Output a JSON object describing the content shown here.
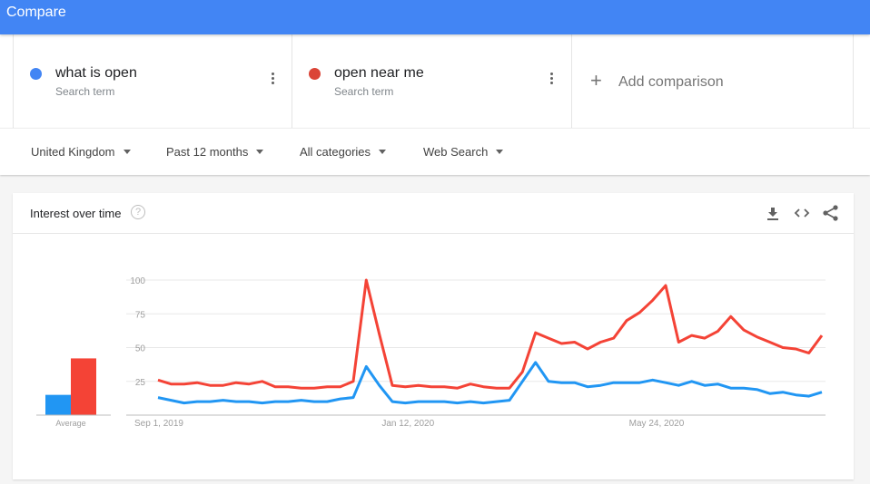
{
  "header": {
    "title": "Compare"
  },
  "terms": [
    {
      "name": "what is open",
      "subtitle": "Search term",
      "color": "#4285f4"
    },
    {
      "name": "open near me",
      "subtitle": "Search term",
      "color": "#db4437"
    }
  ],
  "add_comparison": {
    "label": "Add comparison",
    "icon": "plus-icon"
  },
  "filters": [
    {
      "label": "United Kingdom"
    },
    {
      "label": "Past 12 months"
    },
    {
      "label": "All categories"
    },
    {
      "label": "Web Search"
    }
  ],
  "card": {
    "title": "Interest over time",
    "help_glyph": "?",
    "actions": [
      "download-icon",
      "embed-code-icon",
      "share-icon"
    ]
  },
  "chart_data": {
    "type": "line",
    "title": "Interest over time",
    "xlabel": "",
    "ylabel": "",
    "ylim": [
      0,
      100
    ],
    "yticks": [
      25,
      50,
      75,
      100
    ],
    "grid": true,
    "x_tick_labels": [
      {
        "label": "Sep 1, 2019",
        "index": 0
      },
      {
        "label": "Jan 12, 2020",
        "index": 19
      },
      {
        "label": "May 24, 2020",
        "index": 38
      }
    ],
    "series": [
      {
        "name": "what is open",
        "color": "#2196f3",
        "values": [
          13,
          11,
          9,
          10,
          10,
          11,
          10,
          10,
          9,
          10,
          10,
          11,
          10,
          10,
          12,
          13,
          36,
          22,
          10,
          9,
          10,
          10,
          10,
          9,
          10,
          9,
          10,
          11,
          25,
          39,
          25,
          24,
          24,
          21,
          22,
          24,
          24,
          24,
          26,
          24,
          22,
          25,
          22,
          23,
          20,
          20,
          19,
          16,
          17,
          15,
          14,
          17
        ]
      },
      {
        "name": "open near me",
        "color": "#f44336",
        "values": [
          26,
          23,
          23,
          24,
          22,
          22,
          24,
          23,
          25,
          21,
          21,
          20,
          20,
          21,
          21,
          25,
          100,
          60,
          22,
          21,
          22,
          21,
          21,
          20,
          23,
          21,
          20,
          20,
          32,
          61,
          57,
          53,
          54,
          49,
          54,
          57,
          70,
          76,
          85,
          96,
          54,
          59,
          57,
          62,
          73,
          63,
          58,
          54,
          50,
          49,
          46,
          59
        ]
      }
    ],
    "averages": {
      "label": "Average",
      "values": [
        {
          "name": "what is open",
          "value": 15,
          "color": "#2196f3"
        },
        {
          "name": "open near me",
          "value": 42,
          "color": "#f44336"
        }
      ]
    }
  }
}
